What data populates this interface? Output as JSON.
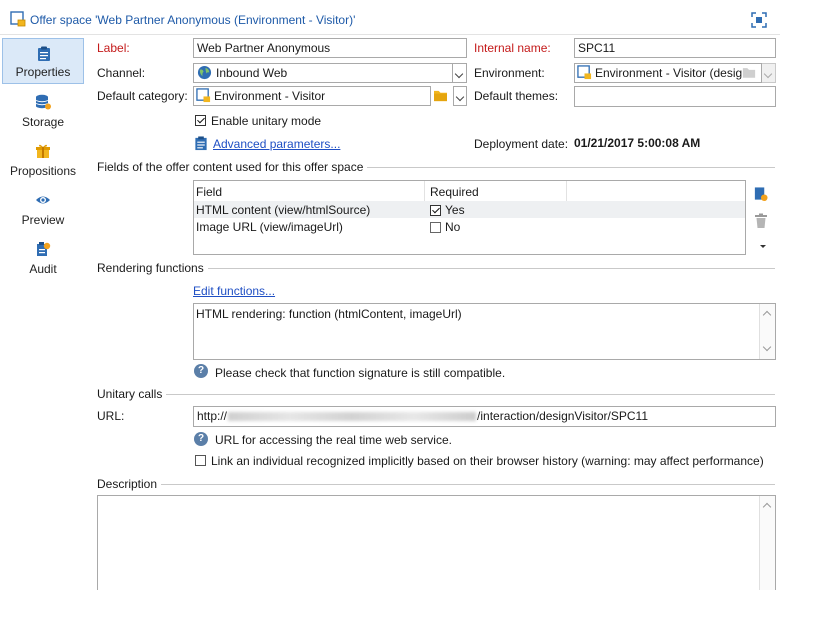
{
  "window": {
    "title": "Offer space 'Web Partner Anonymous (Environment - Visitor)'"
  },
  "sidebar": {
    "items": [
      {
        "label": "Properties",
        "icon": "clipboard-icon",
        "active": true
      },
      {
        "label": "Storage",
        "icon": "database-icon"
      },
      {
        "label": "Propositions",
        "icon": "gift-icon"
      },
      {
        "label": "Preview",
        "icon": "eye-icon"
      },
      {
        "label": "Audit",
        "icon": "audit-icon"
      }
    ]
  },
  "form": {
    "label_label": "Label:",
    "label_value": "Web Partner Anonymous",
    "internal_name_label": "Internal name:",
    "internal_name_value": "SPC11",
    "channel_label": "Channel:",
    "channel_value": "Inbound Web",
    "environment_label": "Environment:",
    "environment_value": "Environment - Visitor (desig",
    "default_category_label": "Default category:",
    "default_category_value": "Environment - Visitor",
    "default_themes_label": "Default themes:",
    "default_themes_value": "",
    "enable_unitary_label": "Enable unitary mode",
    "advanced_link": "Advanced parameters...",
    "deployment_label": "Deployment date:",
    "deployment_value": "01/21/2017 5:00:08 AM"
  },
  "fields_section": {
    "title": "Fields of the offer content used for this offer space",
    "columns": [
      "Field",
      "Required"
    ],
    "rows": [
      {
        "field": "HTML content (view/htmlSource)",
        "required": "Yes",
        "checked": true
      },
      {
        "field": "Image URL (view/imageUrl)",
        "required": "No",
        "checked": false
      }
    ]
  },
  "rendering": {
    "title": "Rendering functions",
    "edit_link": "Edit functions...",
    "content": "HTML rendering: function (htmlContent, imageUrl)",
    "hint": "Please check that function signature is still compatible."
  },
  "unitary": {
    "title": "Unitary calls",
    "url_label": "URL:",
    "url_prefix": "http://",
    "url_suffix": "/interaction/designVisitor/SPC11",
    "url_hint": "URL for accessing the real time web service.",
    "link_individual_label": "Link an individual recognized implicitly based on their browser history (warning: may affect performance)"
  },
  "description": {
    "title": "Description",
    "value": ""
  },
  "colors": {
    "accent": "#1e5aa8",
    "required_label": "#c41a1a",
    "active_tab": "#dbe9f8"
  }
}
